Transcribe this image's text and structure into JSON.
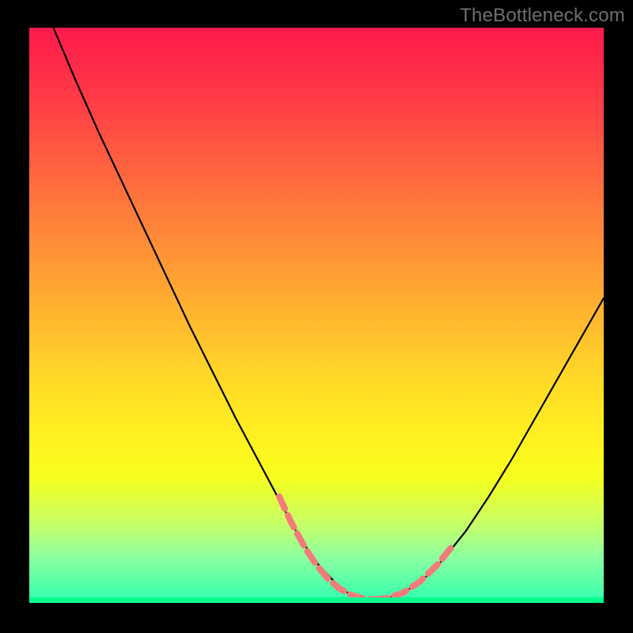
{
  "watermark": "TheBottleneck.com",
  "chart_data": {
    "type": "line",
    "title": "",
    "xlabel": "",
    "ylabel": "",
    "xlim": [
      0,
      100
    ],
    "ylim": [
      0,
      100
    ],
    "grid": false,
    "series": [
      {
        "name": "bottleneck-curve",
        "color": "#000000",
        "stroke_width": 2.2,
        "x": [
          4.2,
          8,
          12,
          16,
          20,
          24,
          28,
          32,
          36,
          40,
          44,
          47,
          50,
          53,
          55,
          57,
          59,
          61,
          64,
          68,
          72,
          76,
          80,
          84,
          88,
          92,
          96,
          100
        ],
        "y": [
          100,
          91,
          82,
          73.5,
          65,
          56.5,
          48,
          40,
          32,
          24.5,
          17,
          11.5,
          7,
          3.8,
          2,
          1.0,
          0.6,
          0.6,
          1.2,
          3.5,
          7.5,
          12.5,
          18.5,
          25,
          32,
          39,
          46,
          53
        ]
      },
      {
        "name": "optimal-band-left",
        "color": "#f37b7a",
        "stroke_width": 8,
        "dash": [
          17,
          9
        ],
        "x": [
          43.5,
          45.5,
          48,
          50,
          52,
          54,
          56,
          58,
          60
        ],
        "y": [
          18.5,
          14.2,
          9.6,
          6.6,
          4.2,
          2.5,
          1.4,
          0.8,
          0.6
        ]
      },
      {
        "name": "optimal-band-right",
        "color": "#f37b7a",
        "stroke_width": 8,
        "dash": [
          17,
          9
        ],
        "x": [
          60,
          62,
          65,
          68,
          71,
          74
        ],
        "y": [
          0.6,
          0.8,
          1.7,
          3.7,
          6.6,
          10.3
        ]
      }
    ],
    "gradient_stops": [
      {
        "pos": 0.0,
        "color": "#ff1a4c"
      },
      {
        "pos": 0.12,
        "color": "#ff3a46"
      },
      {
        "pos": 0.28,
        "color": "#ff6f3d"
      },
      {
        "pos": 0.44,
        "color": "#ffa233"
      },
      {
        "pos": 0.6,
        "color": "#ffd628"
      },
      {
        "pos": 0.72,
        "color": "#fff31f"
      },
      {
        "pos": 0.78,
        "color": "#f7ff1c"
      },
      {
        "pos": 0.86,
        "color": "#c9ff65"
      },
      {
        "pos": 0.92,
        "color": "#8dffa0"
      },
      {
        "pos": 1.0,
        "color": "#2effb0"
      }
    ]
  }
}
